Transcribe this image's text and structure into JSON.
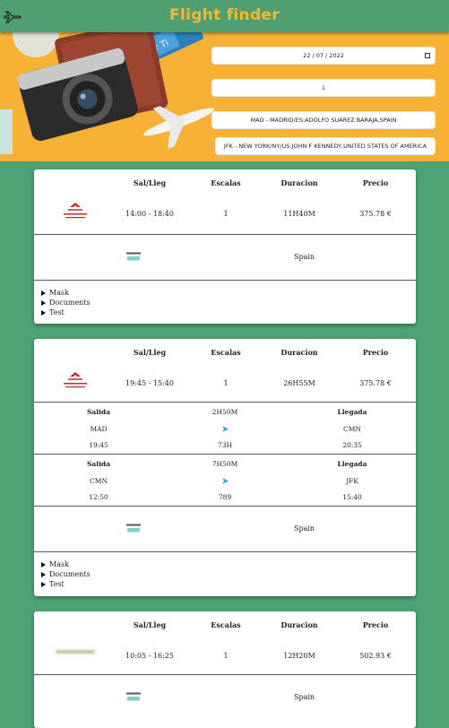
{
  "header": {
    "title": "Flight finder"
  },
  "search": {
    "date": "22 / 07 / 2022",
    "passengers": "1",
    "origin": "MAD - MADRID/ES:ADOLFO SUAREZ BARAJA,SPAIN",
    "destination": "JFK - NEW YORK/NY/US:JOHN F KENNEDY,UNITED STATES OF AMERICA"
  },
  "columns": {
    "times": "Sal/Lleg",
    "stops": "Escalas",
    "duration": "Duracion",
    "price": "Precio"
  },
  "legs_labels": {
    "departure": "Salida",
    "arrival": "Llegada"
  },
  "flights": [
    {
      "times": "14:00 - 18:40",
      "stops": "1",
      "duration": "11H40M",
      "price": "375.78 €",
      "country": "Spain",
      "details": [
        "Mask",
        "Documents",
        "Test"
      ]
    },
    {
      "times": "19:45 - 15:40",
      "stops": "1",
      "duration": "26H55M",
      "price": "375.78 €",
      "legs": [
        {
          "from": "MAD",
          "dep": "19:45",
          "duration": "2H50M",
          "flight": "73H",
          "to": "CMN",
          "arr": "20:35"
        },
        {
          "from": "CMN",
          "dep": "12:50",
          "duration": "7H50M",
          "flight": "789",
          "to": "JFK",
          "arr": "15:40"
        }
      ],
      "country": "Spain",
      "details": [
        "Mask",
        "Documents",
        "Test"
      ]
    },
    {
      "times": "10:05 - 16:25",
      "stops": "1",
      "duration": "12H20M",
      "price": "502.93 €",
      "country": "Spain"
    }
  ],
  "colors": {
    "background": "#4ea374",
    "title": "#f5b733",
    "hero": "#f7b135"
  }
}
